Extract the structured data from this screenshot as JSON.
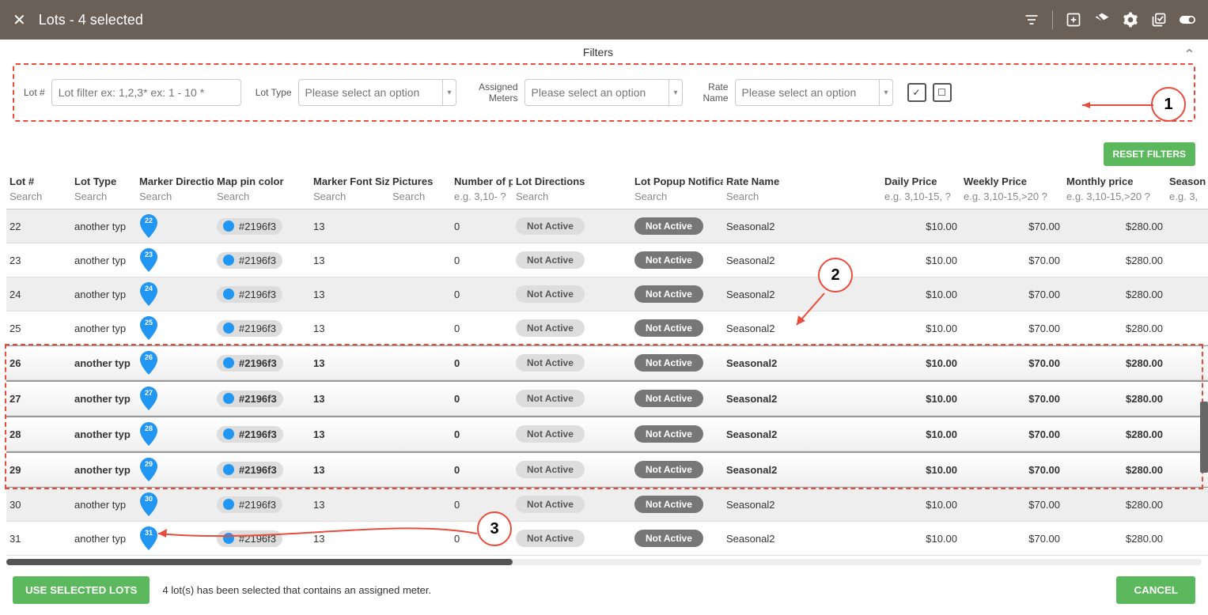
{
  "header": {
    "title": "Lots  - 4 selected"
  },
  "filters": {
    "title": "Filters",
    "lotnum": {
      "label": "Lot #",
      "placeholder": "Lot filter ex: 1,2,3* ex: 1 - 10 *"
    },
    "lottype": {
      "label": "Lot Type",
      "placeholder": "Please select an option"
    },
    "meters": {
      "label": "Assigned Meters",
      "placeholder": "Please select an option"
    },
    "ratename": {
      "label": "Rate Name",
      "placeholder": "Please select an option"
    }
  },
  "buttons": {
    "reset": "RESET FILTERS",
    "use": "USE SELECTED LOTS",
    "cancel": "CANCEL"
  },
  "table": {
    "headers": [
      "Lot #",
      "Lot Type",
      "Marker Direction",
      "Map pin color",
      "Marker Font Size",
      "Pictures",
      "Number of p",
      "Lot Directions",
      "Lot Popup Notificat",
      "Rate Name",
      "Daily Price",
      "Weekly Price",
      "Monthly price",
      "Season"
    ],
    "search": [
      "Search",
      "Search",
      "Search",
      "Search",
      "Search",
      "Search",
      "e.g. 3,10- ?",
      "Search",
      "Search",
      "Search",
      "e.g. 3,10-15, ?",
      "e.g. 3,10-15,>20  ?",
      "e.g. 3,10-15,>20  ?",
      "e.g. 3,"
    ],
    "rows": [
      {
        "lot": "22",
        "type": "another typ",
        "color": "#2196f3",
        "font": "13",
        "pics": "",
        "num": "0",
        "dir": "Not Active",
        "popup": "Not Active",
        "rate": "Seasonal2",
        "daily": "$10.00",
        "weekly": "$70.00",
        "monthly": "$280.00",
        "sel": false
      },
      {
        "lot": "23",
        "type": "another typ",
        "color": "#2196f3",
        "font": "13",
        "pics": "",
        "num": "0",
        "dir": "Not Active",
        "popup": "Not Active",
        "rate": "Seasonal2",
        "daily": "$10.00",
        "weekly": "$70.00",
        "monthly": "$280.00",
        "sel": false
      },
      {
        "lot": "24",
        "type": "another typ",
        "color": "#2196f3",
        "font": "13",
        "pics": "",
        "num": "0",
        "dir": "Not Active",
        "popup": "Not Active",
        "rate": "Seasonal2",
        "daily": "$10.00",
        "weekly": "$70.00",
        "monthly": "$280.00",
        "sel": false
      },
      {
        "lot": "25",
        "type": "another typ",
        "color": "#2196f3",
        "font": "13",
        "pics": "",
        "num": "0",
        "dir": "Not Active",
        "popup": "Not Active",
        "rate": "Seasonal2",
        "daily": "$10.00",
        "weekly": "$70.00",
        "monthly": "$280.00",
        "sel": false
      },
      {
        "lot": "26",
        "type": "another typ",
        "color": "#2196f3",
        "font": "13",
        "pics": "",
        "num": "0",
        "dir": "Not Active",
        "popup": "Not Active",
        "rate": "Seasonal2",
        "daily": "$10.00",
        "weekly": "$70.00",
        "monthly": "$280.00",
        "sel": true
      },
      {
        "lot": "27",
        "type": "another typ",
        "color": "#2196f3",
        "font": "13",
        "pics": "",
        "num": "0",
        "dir": "Not Active",
        "popup": "Not Active",
        "rate": "Seasonal2",
        "daily": "$10.00",
        "weekly": "$70.00",
        "monthly": "$280.00",
        "sel": true
      },
      {
        "lot": "28",
        "type": "another typ",
        "color": "#2196f3",
        "font": "13",
        "pics": "",
        "num": "0",
        "dir": "Not Active",
        "popup": "Not Active",
        "rate": "Seasonal2",
        "daily": "$10.00",
        "weekly": "$70.00",
        "monthly": "$280.00",
        "sel": true
      },
      {
        "lot": "29",
        "type": "another typ",
        "color": "#2196f3",
        "font": "13",
        "pics": "",
        "num": "0",
        "dir": "Not Active",
        "popup": "Not Active",
        "rate": "Seasonal2",
        "daily": "$10.00",
        "weekly": "$70.00",
        "monthly": "$280.00",
        "sel": true
      },
      {
        "lot": "30",
        "type": "another typ",
        "color": "#2196f3",
        "font": "13",
        "pics": "",
        "num": "0",
        "dir": "Not Active",
        "popup": "Not Active",
        "rate": "Seasonal2",
        "daily": "$10.00",
        "weekly": "$70.00",
        "monthly": "$280.00",
        "sel": false
      },
      {
        "lot": "31",
        "type": "another typ",
        "color": "#2196f3",
        "font": "13",
        "pics": "",
        "num": "0",
        "dir": "Not Active",
        "popup": "Not Active",
        "rate": "Seasonal2",
        "daily": "$10.00",
        "weekly": "$70.00",
        "monthly": "$280.00",
        "sel": false
      }
    ]
  },
  "footer": {
    "msg": "4 lot(s) has been selected that contains an assigned meter."
  },
  "annotations": {
    "a1": "1",
    "a2": "2",
    "a3": "3"
  }
}
